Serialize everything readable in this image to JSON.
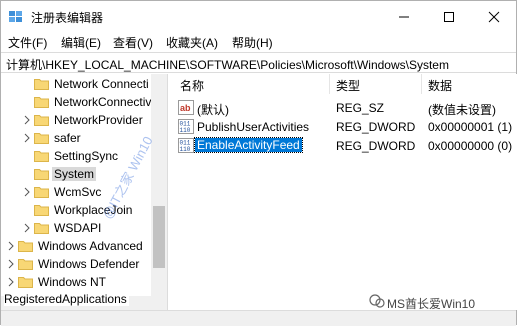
{
  "window": {
    "title": "注册表编辑器"
  },
  "menu": {
    "file": "文件(F)",
    "edit": "编辑(E)",
    "view": "查看(V)",
    "favorites": "收藏夹(A)",
    "help": "帮助(H)"
  },
  "address": {
    "path": "计算机\\HKEY_LOCAL_MACHINE\\SOFTWARE\\Policies\\Microsoft\\Windows\\System"
  },
  "tree": {
    "items": [
      {
        "label": "Network Connecti"
      },
      {
        "label": "NetworkConnectiv"
      },
      {
        "label": "NetworkProvider"
      },
      {
        "label": "safer"
      },
      {
        "label": "SettingSync"
      },
      {
        "label": "System"
      },
      {
        "label": "WcmSvc"
      },
      {
        "label": "WorkplaceJoin"
      },
      {
        "label": "WSDAPI"
      },
      {
        "label": "Windows Advanced"
      },
      {
        "label": "Windows Defender"
      },
      {
        "label": "Windows NT"
      }
    ],
    "bottom_item": "RegisteredApplications"
  },
  "list": {
    "headers": {
      "name": "名称",
      "type": "类型",
      "data": "数据"
    },
    "rows": [
      {
        "name": "(默认)",
        "type": "REG_SZ",
        "data": "(数值未设置)",
        "icon": "string-value-icon"
      },
      {
        "name": "PublishUserActivities",
        "type": "REG_DWORD",
        "data": "0x00000001 (1)",
        "icon": "dword-value-icon"
      },
      {
        "name": "EnableActivityFeed",
        "type": "REG_DWORD",
        "data": "0x00000000 (0)",
        "icon": "dword-value-icon"
      }
    ]
  },
  "watermarks": {
    "diagonal": "@IT之家 Win10",
    "brand": "MS酋长爱Win10"
  },
  "colors": {
    "selection": "#0078d7",
    "folder": "#f8d775",
    "folder_edge": "#dcb54a"
  }
}
